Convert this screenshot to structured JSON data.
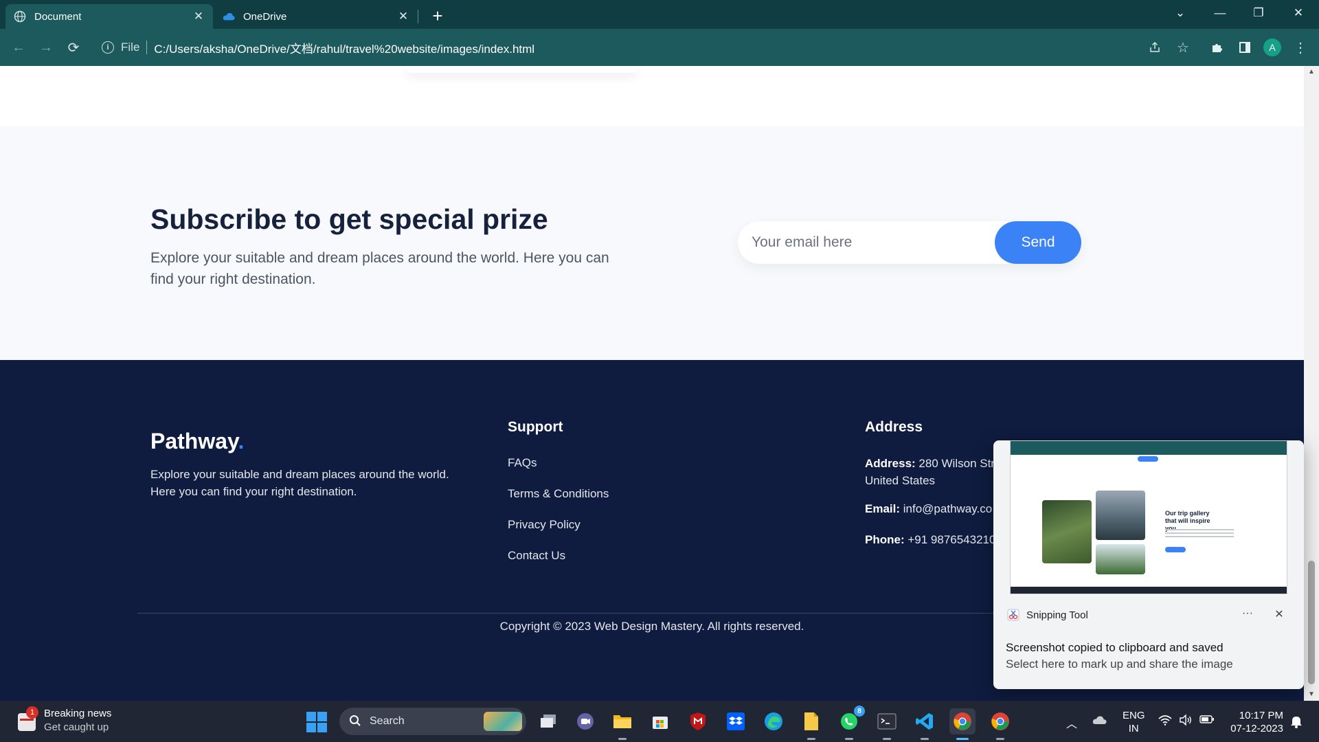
{
  "browser": {
    "tabs": [
      {
        "title": "Document",
        "active": true
      },
      {
        "title": "OneDrive",
        "active": false
      }
    ],
    "address": {
      "scheme": "File",
      "url": "C:/Users/aksha/OneDrive/文档/rahul/travel%20website/images/index.html"
    },
    "profile_initial": "A"
  },
  "subscribe": {
    "title": "Subscribe to get special prize",
    "description": "Explore your suitable and dream places around the world. Here you can find your right destination.",
    "email_placeholder": "Your email here",
    "send_label": "Send"
  },
  "footer": {
    "brand": "Pathway",
    "brand_dot": ".",
    "description": "Explore your suitable and dream places around the world. Here you can find your right destination.",
    "support": {
      "title": "Support",
      "links": [
        "FAQs",
        "Terms & Conditions",
        "Privacy Policy",
        "Contact Us"
      ]
    },
    "address": {
      "title": "Address",
      "address_label": "Address:",
      "address_value": "280 Wilson Str",
      "address_value_2": "United States",
      "email_label": "Email:",
      "email_value": "info@pathway.co",
      "phone_label": "Phone:",
      "phone_value": "+91 9876543210"
    },
    "copyright": "Copyright © 2023 Web Design Mastery. All rights reserved."
  },
  "toast": {
    "app_name": "Snipping Tool",
    "preview_heading": "Our trip gallery that will inspire you",
    "message": "Screenshot copied to clipboard and saved",
    "submessage": "Select here to mark up and share the image"
  },
  "taskbar": {
    "news_title": "Breaking news",
    "news_subtitle": "Get caught up",
    "news_badge": "1",
    "search_label": "Search",
    "whatsapp_badge": "8",
    "language_1": "ENG",
    "language_2": "IN",
    "time": "10:17 PM",
    "date": "07-12-2023"
  },
  "colors": {
    "accent": "#3b82f6",
    "footer_bg": "#0f1c3f",
    "chrome_bg": "#1c5a5e",
    "titlebar_bg": "#0f3d42",
    "taskbar_bg": "#202633"
  }
}
